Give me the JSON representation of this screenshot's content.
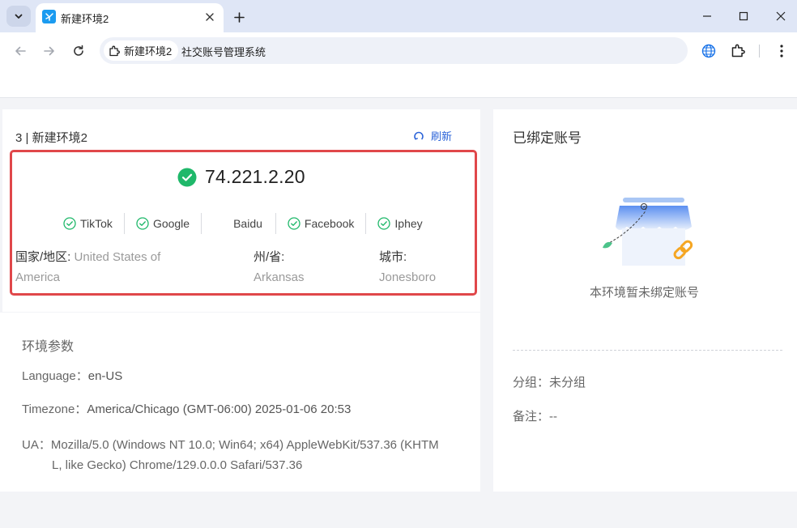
{
  "browser": {
    "tab_title": "新建环境2",
    "chip_label": "新建环境2",
    "url_text": "社交账号管理系统"
  },
  "environment": {
    "title": "3 | 新建环境2",
    "refresh_label": "刷新",
    "ip": "74.221.2.20",
    "sites": [
      {
        "name": "TikTok",
        "checked": true
      },
      {
        "name": "Google",
        "checked": true
      },
      {
        "name": "Baidu",
        "checked": false
      },
      {
        "name": "Facebook",
        "checked": true
      },
      {
        "name": "Iphey",
        "checked": true
      }
    ],
    "country_label": "国家/地区:",
    "country_value_line1": "United States of",
    "country_value_line2": "America",
    "state_label": "州/省:",
    "state_value": "Arkansas",
    "city_label": "城市:",
    "city_value": "Jonesboro"
  },
  "params": {
    "heading": "环境参数",
    "language_label": "Language：",
    "language_value": "en-US",
    "timezone_label": "Timezone：",
    "timezone_value": "America/Chicago (GMT-06:00) 2025-01-06 20:53",
    "ua_label": "UA：",
    "ua_line1": "Mozilla/5.0 (Windows NT 10.0; Win64; x64) AppleWebKit/537.36 (KHTM",
    "ua_line2": "L, like Gecko) Chrome/129.0.0.0 Safari/537.36"
  },
  "bound": {
    "title": "已绑定账号",
    "empty_text": "本环境暂未绑定账号",
    "group_label": "分组：",
    "group_value": "未分组",
    "note_label": "备注：",
    "note_value": "--"
  },
  "colors": {
    "accent": "#2b63d8",
    "success": "#1fb86a",
    "highlight_border": "#e0474a"
  },
  "icons": [
    "chevron-down-icon",
    "app-favicon-icon",
    "close-icon",
    "plus-icon",
    "minimize-icon",
    "maximize-icon",
    "window-close-icon",
    "back-icon",
    "forward-icon",
    "reload-icon",
    "extension-icon",
    "globe-icon",
    "more-icon",
    "refresh-icon",
    "check-circle-icon"
  ]
}
